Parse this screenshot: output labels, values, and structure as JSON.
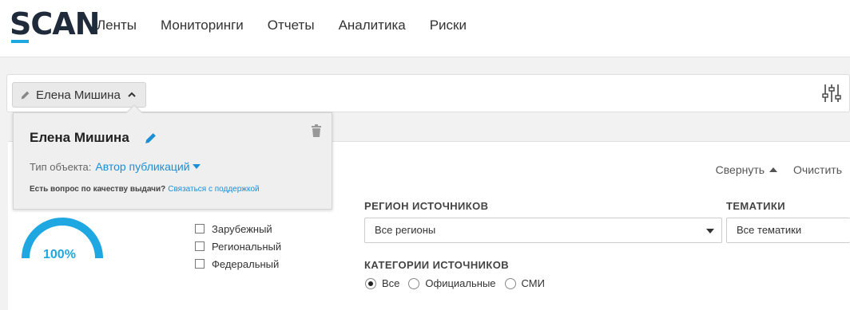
{
  "header": {
    "logo_s": "S",
    "logo_rest": "CAN",
    "nav": [
      "Ленты",
      "Мониторинги",
      "Отчеты",
      "Аналитика",
      "Риски"
    ]
  },
  "search": {
    "chip_label": "Елена Мишина"
  },
  "popover": {
    "name": "Елена Мишина",
    "type_label": "Тип объекта:",
    "type_value": "Автор публикаций",
    "help_question": "Есть вопрос по качеству выдачи?",
    "help_link": "Связаться с поддержкой"
  },
  "panel": {
    "collapse_label": "Свернуть",
    "clear_label": "Очистить",
    "gauge_value": "100%",
    "gauge_fraction": 1.0,
    "checks": [
      "Зарубежный",
      "Региональный",
      "Федеральный"
    ],
    "region_title": "РЕГИОН ИСТОЧНИКОВ",
    "region_value": "Все регионы",
    "themes_title": "ТЕМАТИКИ",
    "themes_value": "Все тематики",
    "categories_title": "КАТЕГОРИИ ИСТОЧНИКОВ",
    "radios": [
      "Все",
      "Официальные",
      "СМИ"
    ],
    "radio_selected": "Все"
  },
  "colors": {
    "accent": "#1ea7e1",
    "link": "#1a8fd6",
    "logo_dark": "#1f2a3a"
  }
}
